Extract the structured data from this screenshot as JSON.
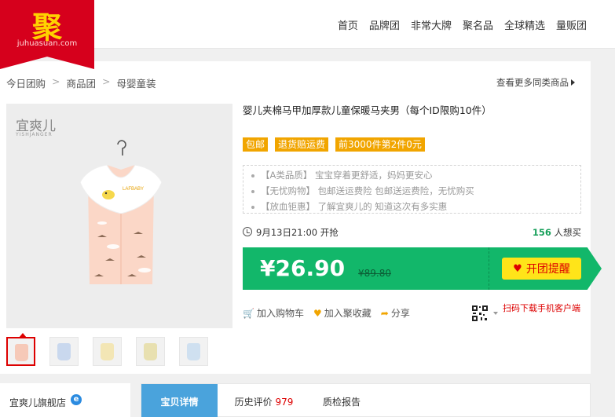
{
  "logo": {
    "char": "聚",
    "domain": "juhuasuan.com",
    "bg_color": "#d6001c"
  },
  "nav": [
    "首页",
    "品牌团",
    "非常大牌",
    "聚名品",
    "全球精选",
    "量贩团"
  ],
  "breadcrumb": [
    "今日团购",
    "商品团",
    "母婴童装"
  ],
  "breadcrumb_separator": ">",
  "more_link": "查看更多同类商品",
  "product": {
    "brand_mark": "宜爽儿",
    "brand_mark_sub": "YISHJANGER",
    "vest_label": "LAFBABY",
    "title": "婴儿夹棉马甲加厚款儿童保暖马夹男（每个ID限购10件）",
    "tags": [
      "包邮",
      "退货赔运费",
      "前3000件第2件0元"
    ],
    "features": [
      "【A类品质】 宝宝穿着更舒适，妈妈更安心",
      "【无忧购物】 包邮送运费险 包邮送运费险，无忧购买",
      "【放血钜惠】 了解宜爽儿的 知道这次有多实惠"
    ],
    "start_time": "9月13日21:00 开抢",
    "sold_count": "156",
    "sold_suffix": " 人想买",
    "price": "¥26.90",
    "original_price": "¥89.80",
    "remind_button": "开团提醒",
    "actions": {
      "cart": "加入购物车",
      "favorite": "加入聚收藏",
      "share": "分享"
    },
    "app_download": "扫码下载手机客户端",
    "thumbnails": [
      "#f6c9b8",
      "#c9d8ee",
      "#f3e6b5",
      "#e8e0b0",
      "#cfe0f0"
    ],
    "active_thumbnail": 1
  },
  "shop": {
    "name": "宜爽儿旗舰店",
    "icon": "ie-icon"
  },
  "tabs": {
    "detail": "宝贝详情",
    "reviews": "历史评价",
    "review_count": "979",
    "quality": "质检报告"
  },
  "colors": {
    "accent_green": "#12b76a",
    "remind_yellow": "#ffe419",
    "tag_orange": "#f1a500",
    "tab_blue": "#4aa3dc"
  }
}
